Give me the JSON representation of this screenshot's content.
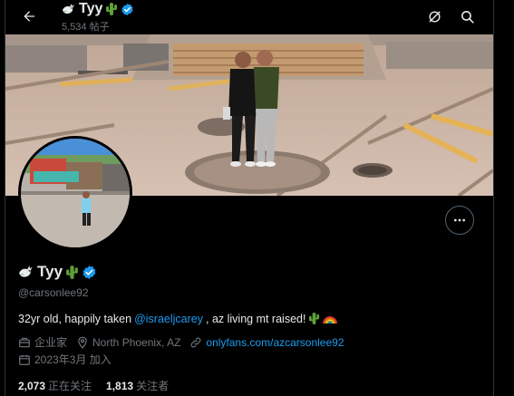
{
  "header": {
    "display_name": "Tyy",
    "post_count": "5,534 帖子"
  },
  "profile": {
    "display_name": "Tyy",
    "handle": "@carsonlee92",
    "bio": {
      "prefix": "32yr old, happily taken ",
      "mention": "@israeljcarey",
      "suffix": ", az living mt raised!"
    },
    "profession": "企业家",
    "location": "North Phoenix, AZ",
    "website": "onlyfans.com/azcarsonlee92",
    "joined": "2023年3月 加入",
    "following_count": "2,073",
    "following_label": "正在关注",
    "followers_count": "1,813",
    "followers_label": "关注者"
  },
  "icons": {
    "back": "arrow-left-icon",
    "dove": "dove-emoji-icon",
    "cactus": "cactus-emoji-icon",
    "rainbow": "rainbow-emoji-icon",
    "verified": "verified-badge-icon",
    "no_translate": "grok-slash-icon",
    "search": "search-icon",
    "more": "more-horizontal-icon",
    "briefcase": "briefcase-icon",
    "location": "location-pin-icon",
    "link": "link-icon",
    "calendar": "calendar-icon"
  },
  "colors": {
    "background": "#000000",
    "text": "#e7e9ea",
    "muted": "#71767b",
    "link": "#1d9bf0",
    "verified": "#1d9bf0"
  }
}
